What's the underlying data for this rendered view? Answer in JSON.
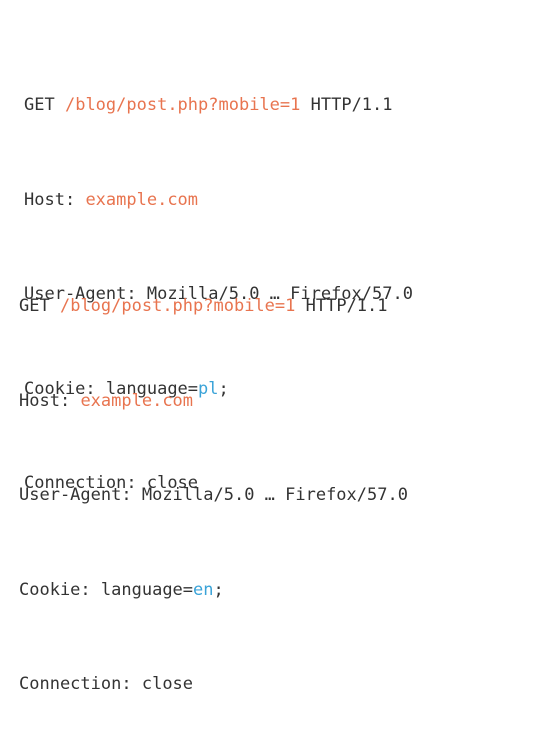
{
  "colors": {
    "text": "#333333",
    "highlight_url": "#e8744f",
    "highlight_value": "#3aa3d8",
    "background": "#ffffff"
  },
  "requests": [
    {
      "method": "GET",
      "path": "/blog/post.php?mobile=1",
      "protocol": "HTTP/1.1",
      "host_label": "Host:",
      "host": "example.com",
      "user_agent_label": "User-Agent:",
      "user_agent": "Mozilla/5.0 … Firefox/57.0",
      "cookie_label": "Cookie:",
      "cookie_key": "language=",
      "cookie_value": "pl",
      "cookie_end": ";",
      "connection_label": "Connection:",
      "connection": "close"
    },
    {
      "method": "GET",
      "path": "/blog/post.php?mobile=1",
      "protocol": "HTTP/1.1",
      "host_label": "Host:",
      "host": "example.com",
      "user_agent_label": "User-Agent:",
      "user_agent": "Mozilla/5.0 … Firefox/57.0",
      "cookie_label": "Cookie:",
      "cookie_key": "language=",
      "cookie_value": "en",
      "cookie_end": ";",
      "connection_label": "Connection:",
      "connection": "close"
    }
  ]
}
